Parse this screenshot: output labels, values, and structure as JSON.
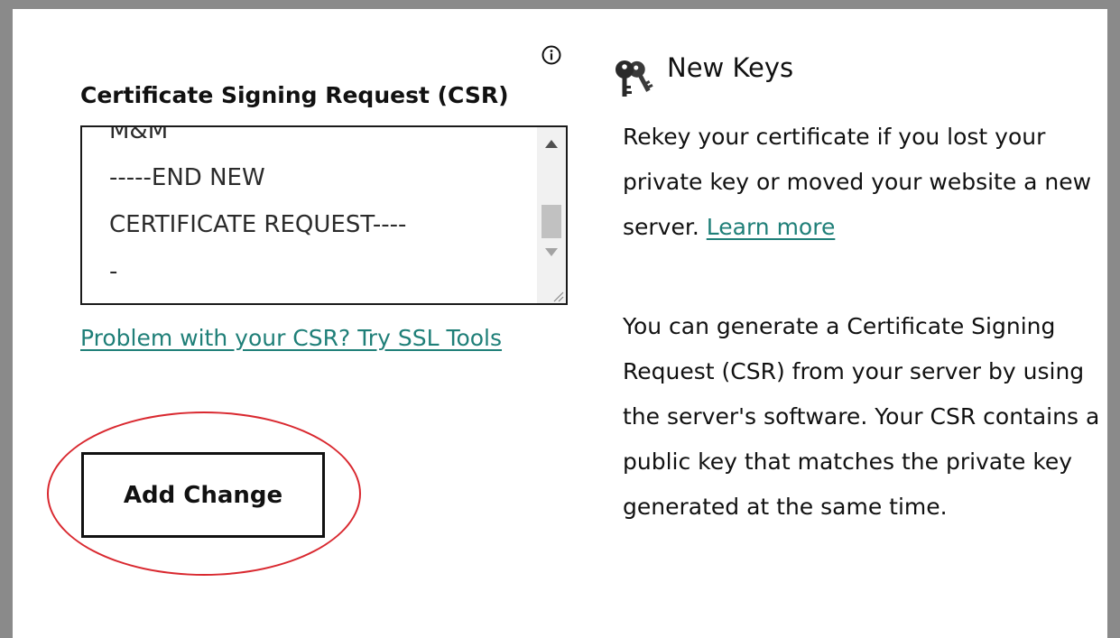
{
  "csr": {
    "label": "Certificate Signing Request (CSR)",
    "value": "M&M\n-----END NEW CERTIFICATE REQUEST-----",
    "visible_text": "M&M\n-----END NEW\nCERTIFICATE REQUEST----\n-",
    "help_link": "Problem with your CSR? Try SSL Tools",
    "submit_label": "Add Change"
  },
  "new_keys": {
    "title": "New Keys",
    "rekey_text": "Rekey your certificate if you lost your private key or moved your website a new server.",
    "learn_more": "Learn more",
    "csr_text": "You can generate a Certificate Signing Request (CSR) from your server by using the server's software. Your CSR contains a public key that matches the private key generated at the same time."
  },
  "icons": {
    "info": "info-icon",
    "keys": "keys-icon"
  },
  "colors": {
    "link": "#1f7f78",
    "annotation_circle": "#d9282f",
    "frame": "#8a8a8a"
  }
}
